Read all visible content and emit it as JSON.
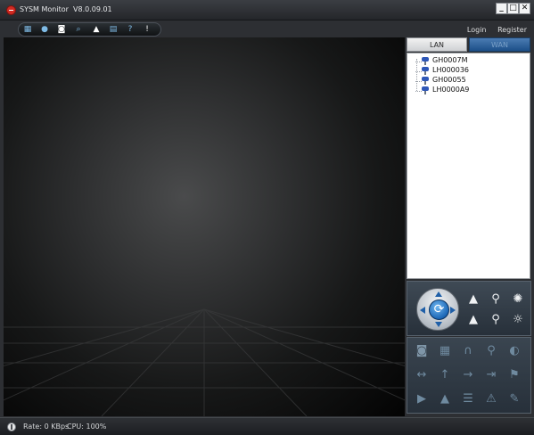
{
  "window": {
    "title": "SYSM Monitor",
    "version": "V8.0.09.01",
    "controls": {
      "minimize": "_",
      "maximize": "□",
      "close": "✕"
    }
  },
  "menu": {
    "login": "Login",
    "register": "Register"
  },
  "toolbar": {
    "buttons": [
      {
        "name": "layout-grid-icon",
        "glyph": "▦"
      },
      {
        "name": "record-icon",
        "glyph": "●"
      },
      {
        "name": "snapshot-camera-icon",
        "glyph": "◙"
      },
      {
        "name": "search-icon",
        "glyph": "⌕"
      },
      {
        "name": "lock-icon",
        "glyph": "▲"
      },
      {
        "name": "storage-icon",
        "glyph": "▤"
      },
      {
        "name": "help-icon",
        "glyph": "?"
      },
      {
        "name": "info-icon",
        "glyph": "!"
      }
    ]
  },
  "tabs": {
    "lan": "LAN",
    "wan": "WAN",
    "active": "LAN"
  },
  "devices": [
    "GH0007M",
    "LH000036",
    "GH00055",
    "LH0000A9"
  ],
  "ptz": {
    "center_glyph": "⟳",
    "buttons": [
      {
        "name": "zoom-in-icon",
        "glyph": "▲"
      },
      {
        "name": "focus-icon",
        "glyph": "⚲"
      },
      {
        "name": "iris-open-icon",
        "glyph": "✺"
      },
      {
        "name": "zoom-out-icon",
        "glyph": "▲"
      },
      {
        "name": "focus-out-icon",
        "glyph": "⚲"
      },
      {
        "name": "iris-close-icon",
        "glyph": "☼"
      }
    ]
  },
  "functions": [
    {
      "name": "snapshot-icon",
      "glyph": "◙"
    },
    {
      "name": "clapperboard-icon",
      "glyph": "▦"
    },
    {
      "name": "headphones-icon",
      "glyph": "∩"
    },
    {
      "name": "microphone-icon",
      "glyph": "⚲"
    },
    {
      "name": "dial-icon",
      "glyph": "◐"
    },
    {
      "name": "horizontal-arrows-icon",
      "glyph": "↔"
    },
    {
      "name": "up-arrow-icon",
      "glyph": "↑"
    },
    {
      "name": "right-arrow-icon",
      "glyph": "→"
    },
    {
      "name": "enter-icon",
      "glyph": "⇥"
    },
    {
      "name": "flag-icon",
      "glyph": "⚑"
    },
    {
      "name": "play-icon",
      "glyph": "▶"
    },
    {
      "name": "triangle-icon",
      "glyph": "▲"
    },
    {
      "name": "wifi-icon",
      "glyph": "☰"
    },
    {
      "name": "warning-icon",
      "glyph": "⚠"
    },
    {
      "name": "wrench-icon",
      "glyph": "✎"
    }
  ],
  "status": {
    "rate": "Rate: 0 KBps",
    "cpu": "CPU: 100%"
  },
  "colors": {
    "accent": "#1f5fa8",
    "wan_tab": "#2a5e97",
    "close_button": "#d02a22"
  }
}
